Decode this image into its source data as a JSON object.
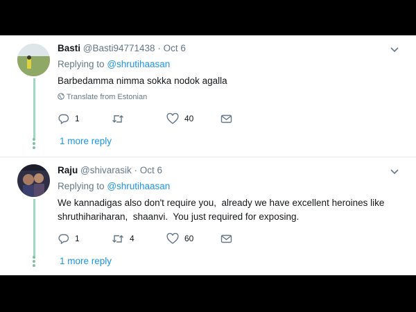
{
  "tweets": [
    {
      "name": "Basti",
      "handle": "@Basti94771438",
      "sep": "·",
      "date": "Oct 6",
      "replying_prefix": "Replying to",
      "replying_to": "@shrutihaasan",
      "text": "Barbedamma nimma sokka nodok agalla",
      "translate": "Translate from Estonian",
      "replies": "1",
      "retweets": "",
      "likes": "40",
      "more_replies": "1 more reply"
    },
    {
      "name": "Raju",
      "handle": "@shivarasik",
      "sep": "·",
      "date": "Oct 6",
      "replying_prefix": "Replying to",
      "replying_to": "@shrutihaasan",
      "text": "We kannadigas also don't require you,  already we have excellent heroines like shruthihariharan,  shaanvi.  You just required for exposing.",
      "replies": "1",
      "retweets": "4",
      "likes": "60",
      "more_replies": "1 more reply"
    }
  ],
  "colors": {
    "link": "#1b95e0",
    "muted": "#657786",
    "thread": "#9fd7c0"
  }
}
